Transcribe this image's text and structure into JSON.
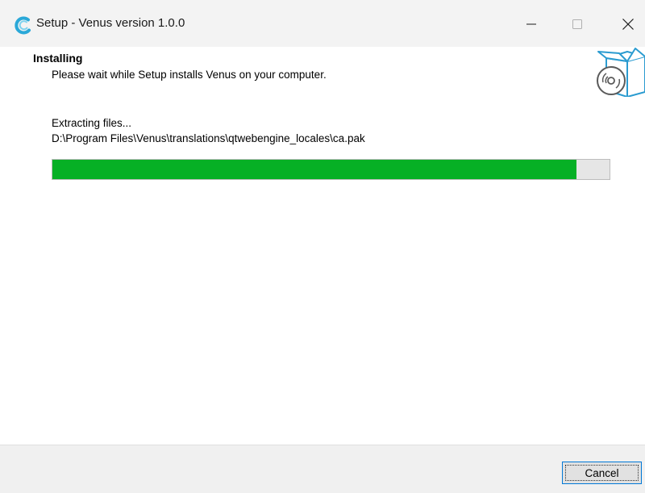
{
  "window": {
    "title": "Setup - Venus version 1.0.0",
    "icon": "venus-app-icon",
    "controls": [
      "minimize-icon",
      "maximize-icon",
      "close-icon"
    ]
  },
  "page": {
    "heading": "Installing",
    "subheading": "Please wait while Setup installs Venus on your computer.",
    "image": "setup-box-disc-icon"
  },
  "progress": {
    "status": "Extracting files...",
    "current_file": "D:\\Program Files\\Venus\\translations\\qtwebengine_locales\\ca.pak",
    "fraction": 0.94,
    "fill_color": "#06b025"
  },
  "footer": {
    "cancel_label": "Cancel"
  }
}
